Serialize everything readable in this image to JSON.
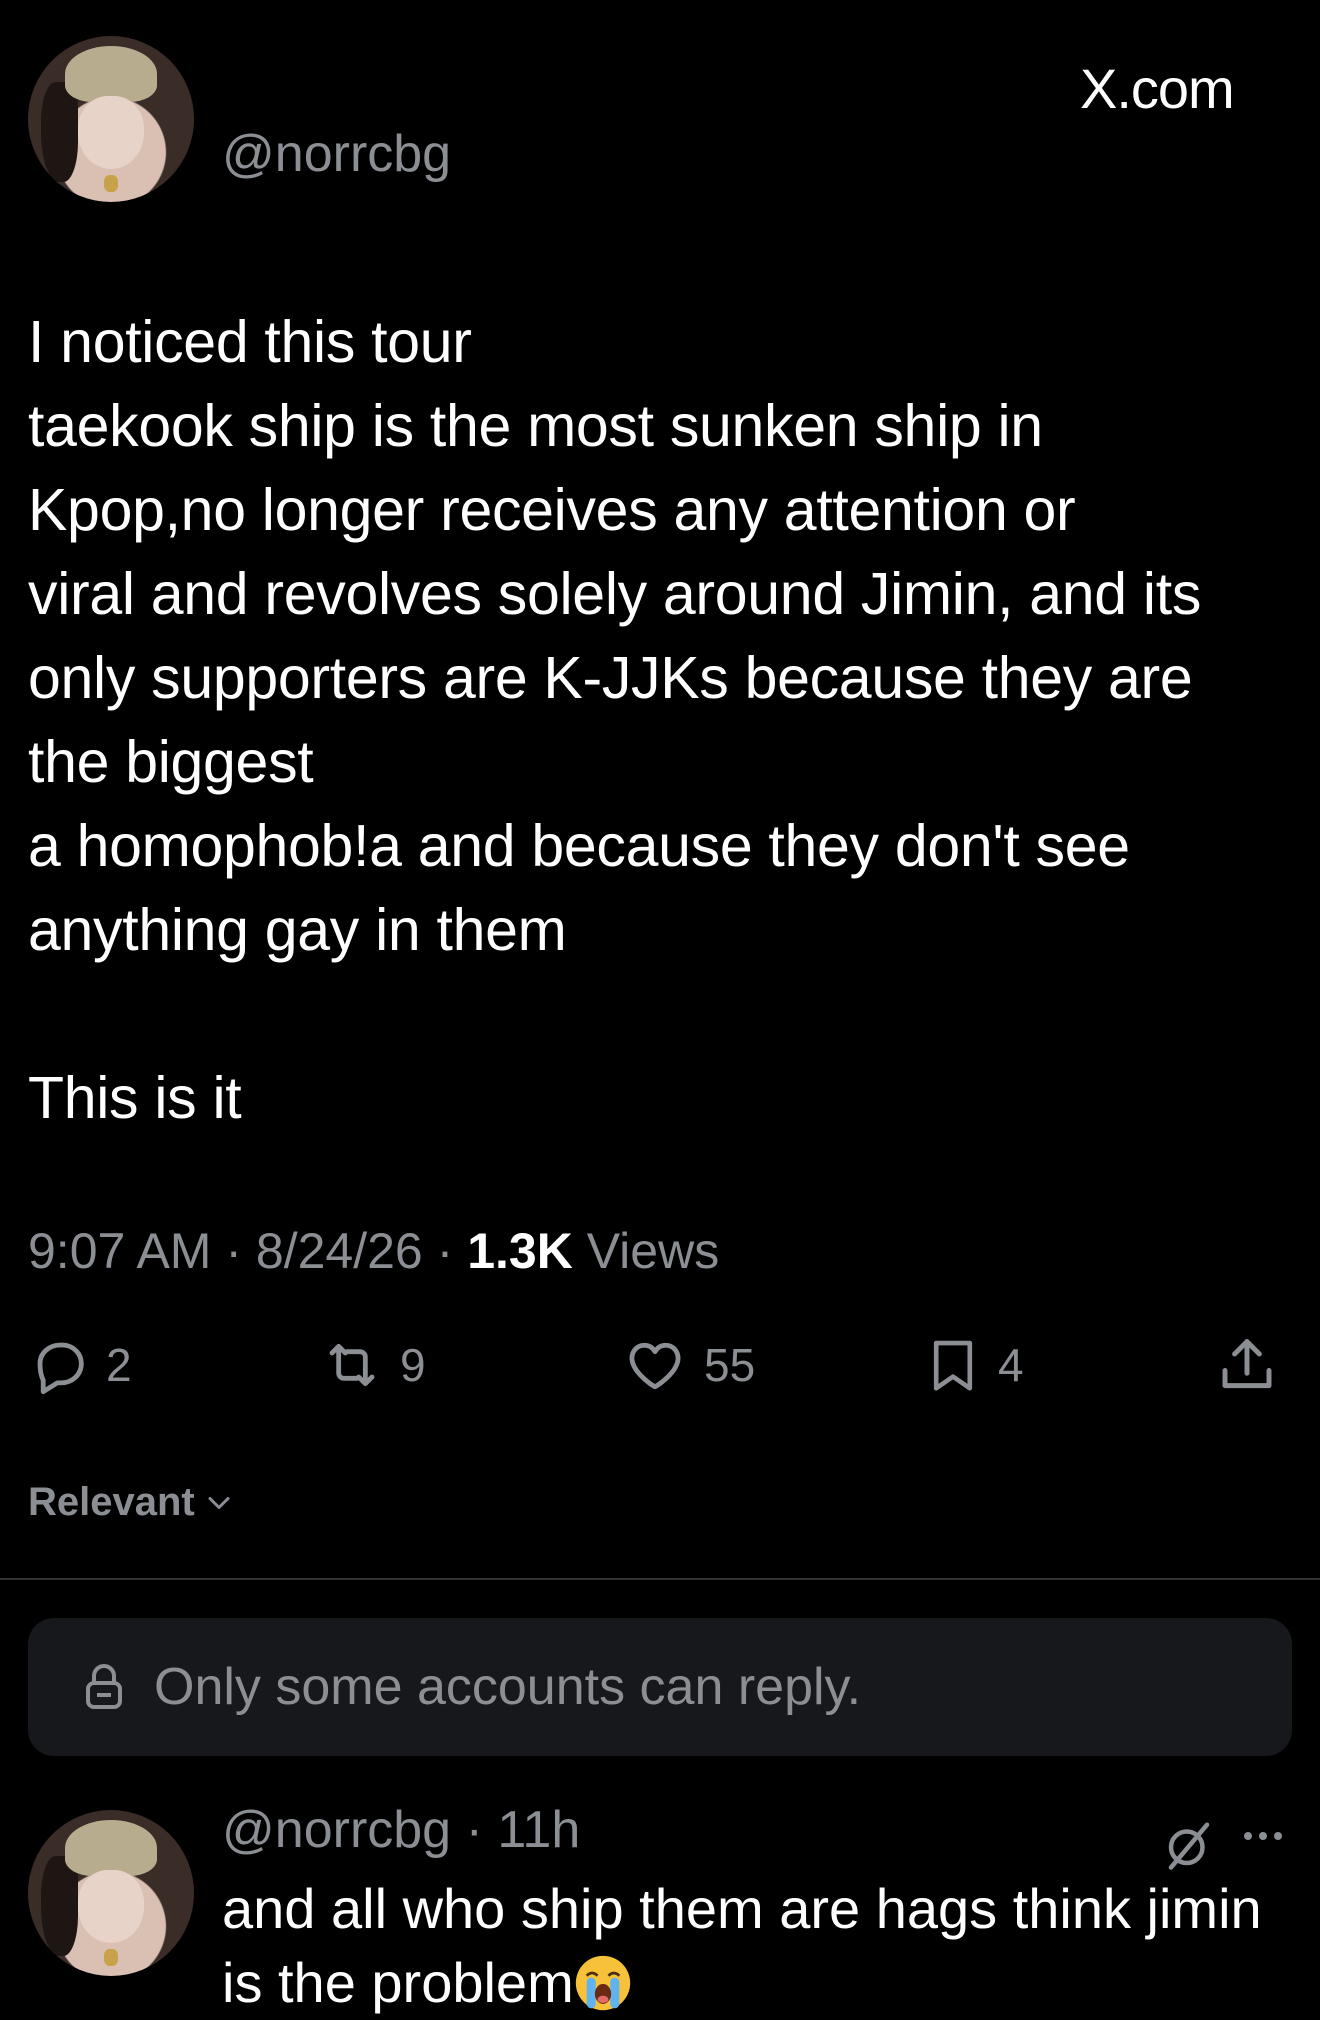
{
  "brand": {
    "text": "X.com"
  },
  "post": {
    "handle": "@norrcbg",
    "body": "I noticed this tour\ntaekook ship is the most sunken ship in\nKpop,no longer receives any attention or\nviral and revolves solely around Jimin, and its\nonly supporters are K-JJKs because they are\nthe biggest\na homophob!a and because they don't see\nanything gay in them\n\nThis is it",
    "time": "9:07 AM",
    "date": "8/24/26",
    "views_count": "1.3K",
    "views_label": "Views",
    "actions": {
      "replies": "2",
      "reposts": "9",
      "likes": "55",
      "bookmarks": "4"
    }
  },
  "sort": {
    "label": "Relevant"
  },
  "reply_restriction": {
    "text": "Only some accounts can reply."
  },
  "reply": {
    "handle": "@norrcbg",
    "age": "11h",
    "text": "and all who ship them are hags think jimin is the problem"
  },
  "colors": {
    "background": "#000000",
    "text_primary": "#ffffff",
    "text_secondary": "#8b8f94",
    "divider": "#2f3336",
    "notice_bg": "#16181c"
  }
}
